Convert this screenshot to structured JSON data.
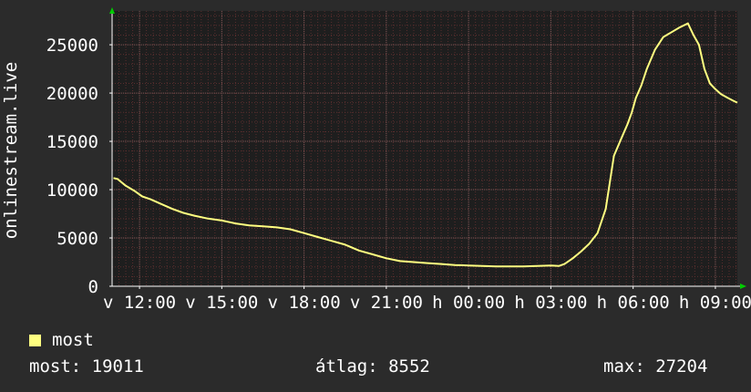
{
  "chart_data": {
    "type": "line",
    "ylabel": "onlinestream.live",
    "ylim": [
      0,
      28500
    ],
    "yticks": [
      0,
      5000,
      10000,
      15000,
      20000,
      25000
    ],
    "ytick_labels": [
      "0",
      "5000",
      "10000",
      "15000",
      "20000",
      "25000"
    ],
    "xlim": [
      11.0,
      33.8
    ],
    "xticks": [
      12,
      15,
      18,
      21,
      24,
      27,
      30,
      33
    ],
    "xtick_labels": [
      "v 12:00",
      "v 15:00",
      "v 18:00",
      "v 21:00",
      "h 00:00",
      "h 03:00",
      "h 06:00",
      "h 09:00"
    ],
    "grid": true,
    "series": [
      {
        "name": "most",
        "color": "#ffff80",
        "x": [
          11.05,
          11.2,
          11.5,
          11.8,
          12.1,
          12.4,
          12.8,
          13.2,
          13.6,
          14.0,
          14.5,
          15.0,
          15.5,
          16.0,
          16.5,
          17.0,
          17.5,
          18.0,
          18.5,
          19.0,
          19.5,
          20.0,
          20.5,
          21.0,
          21.5,
          22.0,
          22.5,
          23.0,
          23.5,
          24.0,
          24.5,
          25.0,
          25.5,
          26.0,
          26.5,
          27.0,
          27.3,
          27.5,
          27.8,
          28.1,
          28.4,
          28.7,
          29.0,
          29.3,
          29.6,
          29.8,
          29.95,
          30.1,
          30.3,
          30.5,
          30.8,
          31.1,
          31.4,
          31.7,
          32.0,
          32.2,
          32.4,
          32.6,
          32.8,
          33.0,
          33.2,
          33.45,
          33.65,
          33.8
        ],
        "values": [
          11200,
          11100,
          10400,
          9900,
          9300,
          9000,
          8500,
          8000,
          7600,
          7300,
          7000,
          6800,
          6500,
          6300,
          6200,
          6100,
          5900,
          5500,
          5100,
          4700,
          4300,
          3700,
          3300,
          2900,
          2600,
          2500,
          2400,
          2300,
          2200,
          2150,
          2100,
          2050,
          2050,
          2050,
          2100,
          2150,
          2100,
          2300,
          2900,
          3600,
          4400,
          5500,
          8000,
          13500,
          15500,
          16800,
          18000,
          19500,
          20800,
          22500,
          24500,
          25800,
          26300,
          26800,
          27204,
          26000,
          25000,
          22500,
          21000,
          20400,
          19900,
          19500,
          19200,
          19011
        ]
      }
    ]
  },
  "legend": {
    "label": "most",
    "swatch_color": "#ffff80"
  },
  "stats": {
    "now": "most: 19011",
    "average": "átlag: 8552",
    "max": "max: 27204"
  }
}
